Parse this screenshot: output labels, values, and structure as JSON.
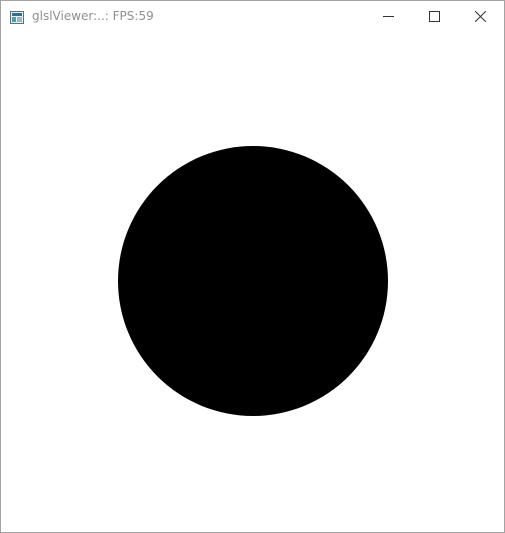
{
  "window": {
    "title": "glslViewer:..: FPS:59",
    "icon": "glslviewer-app-icon",
    "controls": {
      "minimize_icon": "minimize-icon",
      "maximize_icon": "maximize-icon",
      "close_icon": "close-icon"
    }
  },
  "canvas": {
    "background": "#ffffff",
    "shape": "circle",
    "shape_color": "#000000"
  }
}
